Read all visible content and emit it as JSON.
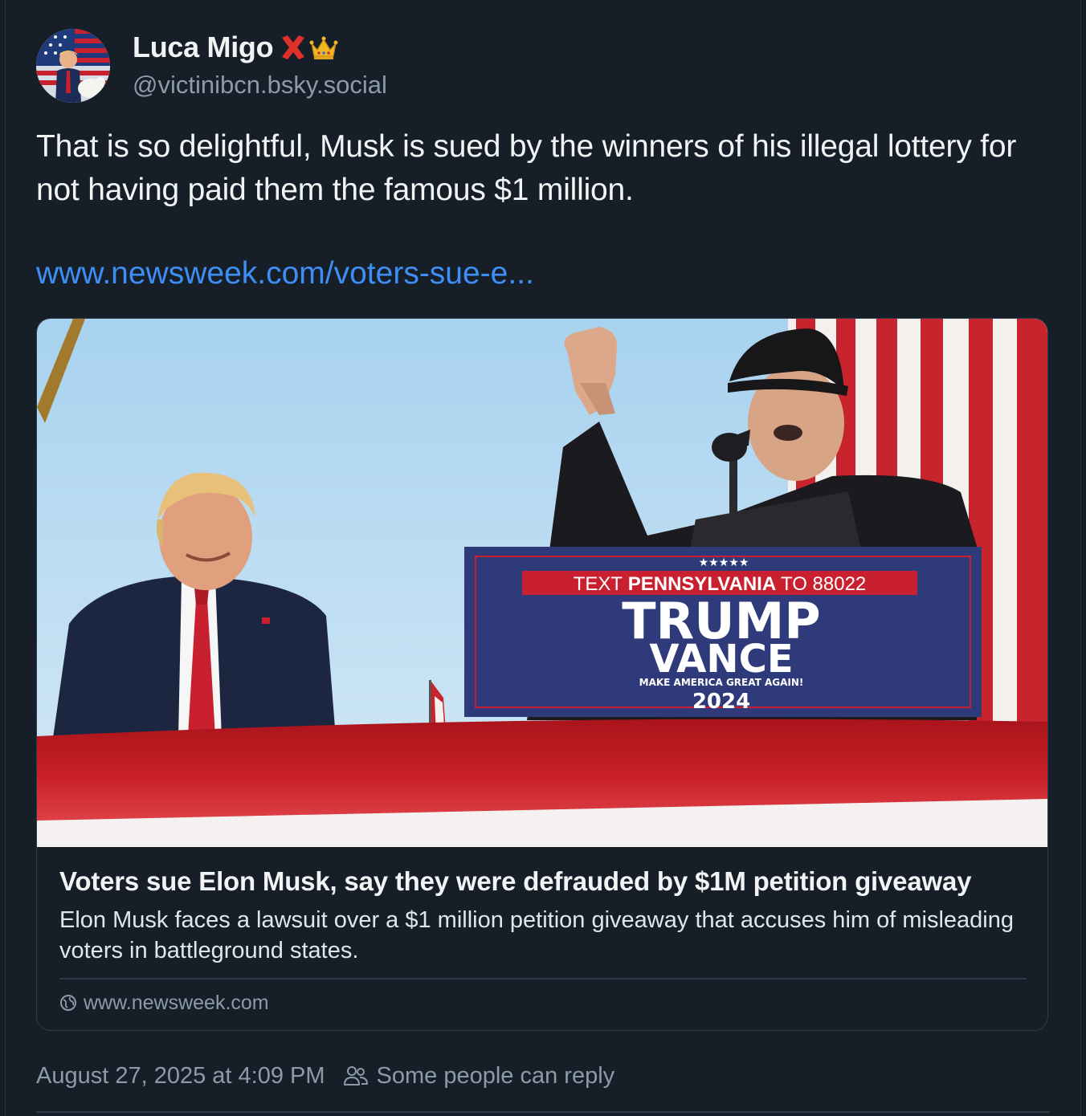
{
  "author": {
    "display_name": "Luca Migo",
    "name_emojis": [
      "red-x-icon",
      "crown-icon"
    ],
    "handle": "@victinibcn.bsky.social",
    "avatar": "avatar-image"
  },
  "post": {
    "text": "That is so delightful, Musk is sued by the winners of his illegal lottery for not having paid them the famous $1 million.",
    "link_text": "www.newsweek.com/voters-sue-e..."
  },
  "link_card": {
    "image": {
      "sign_text_prefix": "TEXT",
      "sign_text_state": "PENNSYLVANIA",
      "sign_text_to": "TO 88022",
      "sign_line1": "TRUMP",
      "sign_line2": "VANCE",
      "sign_slogan": "MAKE AMERICA GREAT AGAIN!",
      "sign_year": "2024",
      "sign_stars": "★★★★★"
    },
    "title": "Voters sue Elon Musk, say they were defrauded by $1M petition giveaway",
    "description": "Elon Musk faces a lawsuit over a $1 million petition giveaway that accuses him of misleading voters in battleground states.",
    "domain": "www.newsweek.com"
  },
  "meta": {
    "timestamp": "August 27, 2025 at 4:09 PM",
    "reply_setting": "Some people can reply"
  },
  "colors": {
    "background": "#161e27",
    "link": "#3d8ff5",
    "muted": "#8c9ba9",
    "border": "#2e3a48"
  }
}
